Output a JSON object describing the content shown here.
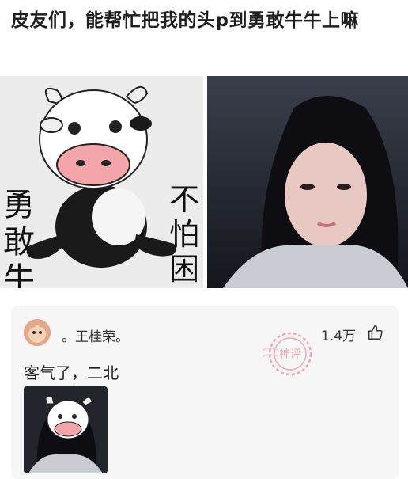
{
  "post": {
    "title": "皮友们，能帮忙把我的头p到勇敢牛牛上嘛"
  },
  "images": {
    "meme": {
      "left_text": "勇敢牛牛",
      "right_text": "不怕困难"
    },
    "selfie": {}
  },
  "comment": {
    "username": "。王桂荣。",
    "likes": "1.4万",
    "text": "客气了，二北",
    "stamp_text": "神评",
    "like_icon": "thumbs-up-icon"
  },
  "colors": {
    "stamp": "#f2a3b4",
    "card_bg": "#f6f6f6"
  }
}
